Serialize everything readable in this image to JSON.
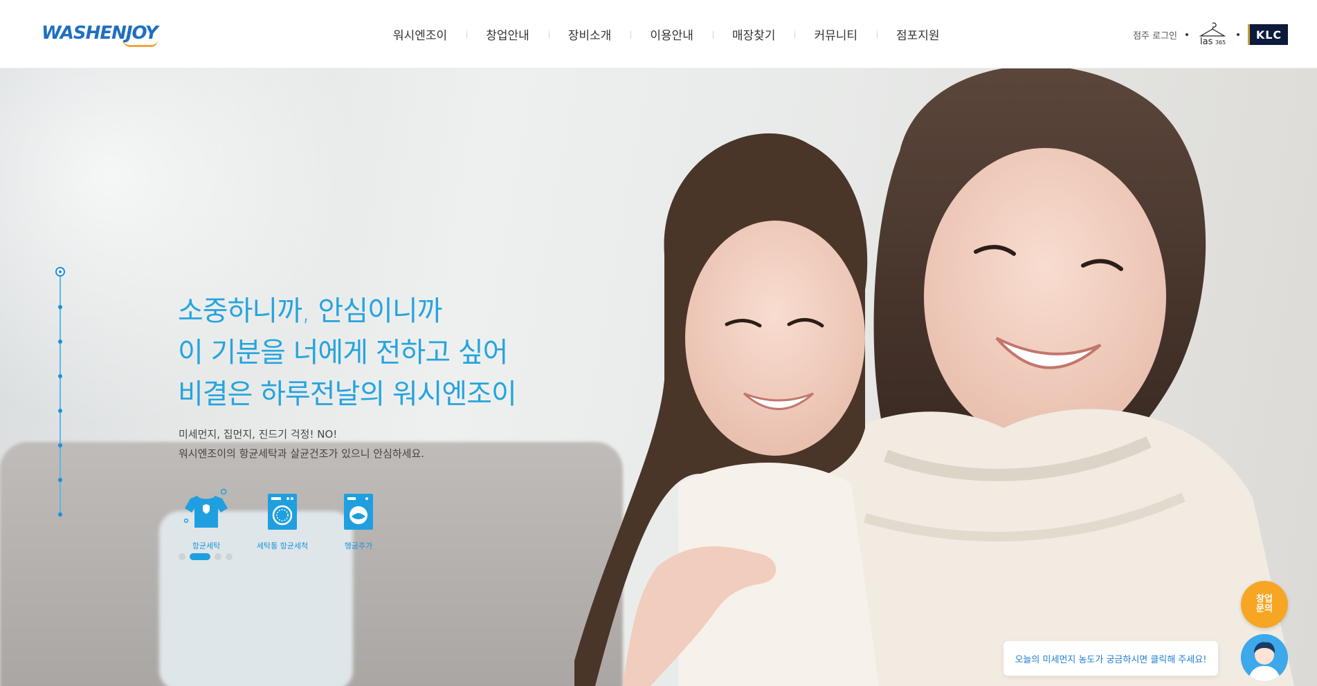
{
  "header": {
    "logo_text": "WASHENJOY",
    "nav": [
      "워시엔조이",
      "창업안내",
      "장비소개",
      "이용안내",
      "매장찾기",
      "커뮤니티",
      "점포지원"
    ],
    "login": "점주 로그인",
    "partner_las": "las365",
    "partner_klc": "KLC"
  },
  "hero": {
    "headline": [
      "소중하니까, 안심이니까",
      "이 기분을 너에게 전하고 싶어",
      "비결은 하루전날의 워시엔조이"
    ],
    "sub": [
      "미세먼지, 집먼지, 진드기 걱정! NO!",
      "워시엔조이의 항균세탁과 살균건조가 있으니 안심하세요."
    ],
    "features": [
      {
        "icon": "tshirt-icon",
        "label": "항균세탁"
      },
      {
        "icon": "washer-icon",
        "label": "세탁통 항균세척"
      },
      {
        "icon": "dryer-icon",
        "label": "헹굼추가"
      }
    ],
    "slides": 4,
    "active_slide": 2
  },
  "floating": {
    "consult": "창업\n문의",
    "chat": "오늘의 미세먼지 농도가 궁금하시면 클릭해 주세요!"
  },
  "colors": {
    "accent": "#26a4dd",
    "orange": "#f6a623",
    "navy": "#0c1a3c"
  }
}
